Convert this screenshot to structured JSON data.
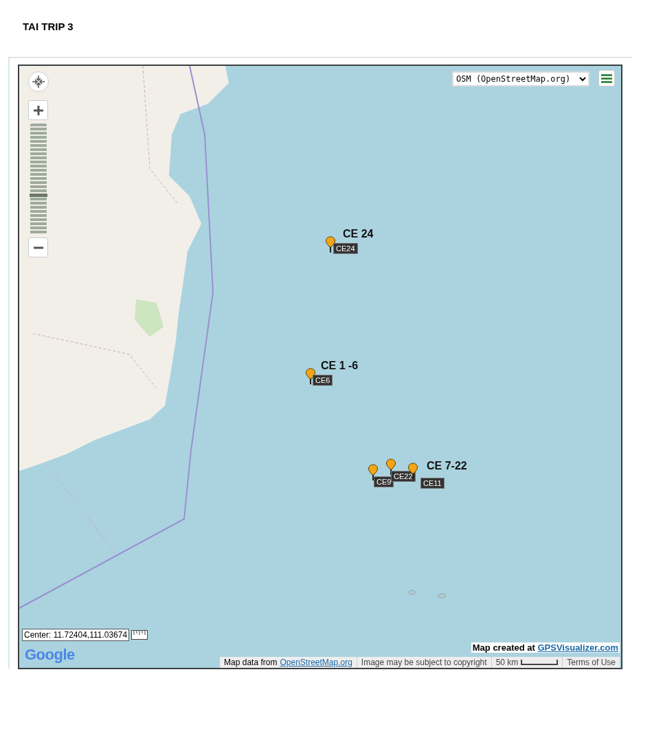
{
  "page": {
    "title": "TAI TRIP 3"
  },
  "map": {
    "layer_select": {
      "value": "OSM (OpenStreetMap.org)"
    },
    "zoom": {
      "level": 0.35
    },
    "groups": [
      {
        "label": "CE 24",
        "waypoints": [
          {
            "tag": "CE24"
          }
        ]
      },
      {
        "label": "CE 1 -6",
        "waypoints": [
          {
            "tag": "CE6"
          }
        ]
      },
      {
        "label": "CE 7-22",
        "waypoints": [
          {
            "tag": "CE9"
          },
          {
            "tag": "CE22"
          },
          {
            "tag": "CE11"
          }
        ]
      }
    ],
    "center": "Center: 11.72404,111.03674",
    "logo": "Google",
    "credit": {
      "text": "Map created at",
      "link": "GPSVisualizer.com"
    },
    "footer": [
      {
        "kind": "link",
        "prefix": "Map data from",
        "link": "OpenStreetMap.org"
      },
      {
        "kind": "text",
        "text": "Image may be subject to copyright"
      },
      {
        "kind": "scale",
        "text": "50 km"
      },
      {
        "kind": "text",
        "text": "Terms of Use"
      }
    ]
  }
}
